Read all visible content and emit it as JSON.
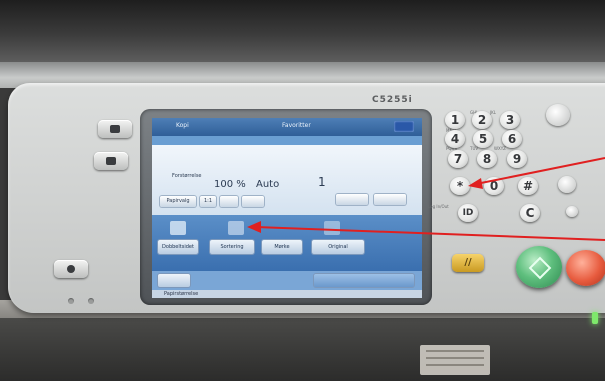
{
  "device": {
    "model": "C5255i"
  },
  "keypad": {
    "keys": [
      "1",
      "2",
      "3",
      "4",
      "5",
      "6",
      "7",
      "8",
      "9",
      "*",
      "0",
      "#"
    ],
    "clear_key": "C",
    "id_key": "ID",
    "group_labels": [
      "GHI",
      "JKL",
      "MNO",
      "PQRS",
      "TUV",
      "WXYZ"
    ],
    "login_label": "Log In/Out"
  },
  "screen": {
    "header_left": "Kopi",
    "header_center": "Favoritter",
    "paper_row_label": "Forstørrelse",
    "zoom_value": "100 %",
    "paper_value": "Auto",
    "copies_value": "1",
    "paper_select_label": "Papirvalg",
    "ratio_label": "1:1",
    "function_buttons": [
      "Dobbeltsidet",
      "Sortering",
      "Mørke",
      "Original"
    ],
    "status_text": "Papirstørrelse"
  },
  "annotations": {
    "arrow_color": "#e02020"
  },
  "colors": {
    "start_button": "#4fb56f",
    "stop_button": "#e0513a",
    "reset_button": "#e6b640",
    "screen_header": "#3a6aa6"
  }
}
